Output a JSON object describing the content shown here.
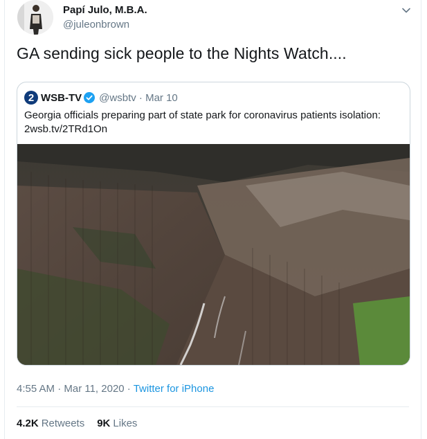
{
  "tweet": {
    "author_name": "Papí Julo, M.B.A.",
    "author_handle": "@juleonbrown",
    "text": "GA sending sick people to the Nights Watch....",
    "timestamp": "4:55 AM · Mar 11, 2020",
    "separator": " · ",
    "source": "Twitter for iPhone",
    "retweets_count": "4.2K",
    "retweets_label": "Retweets",
    "likes_count": "9K",
    "likes_label": "Likes"
  },
  "quoted": {
    "logo_text": "2",
    "name": "WSB-TV",
    "handle_date": "@wsbtv · Mar 10",
    "text_line1": "Georgia officials preparing part of state park for coronavirus patients isolation:",
    "text_line2": "2wsb.tv/2TRd1On"
  },
  "colors": {
    "link": "#1b95e0",
    "muted": "#657786",
    "verified": "#1da1f2",
    "wsb_logo": "#0f3b7a"
  },
  "icons": [
    "chevron-down-icon",
    "verified-badge-icon"
  ]
}
